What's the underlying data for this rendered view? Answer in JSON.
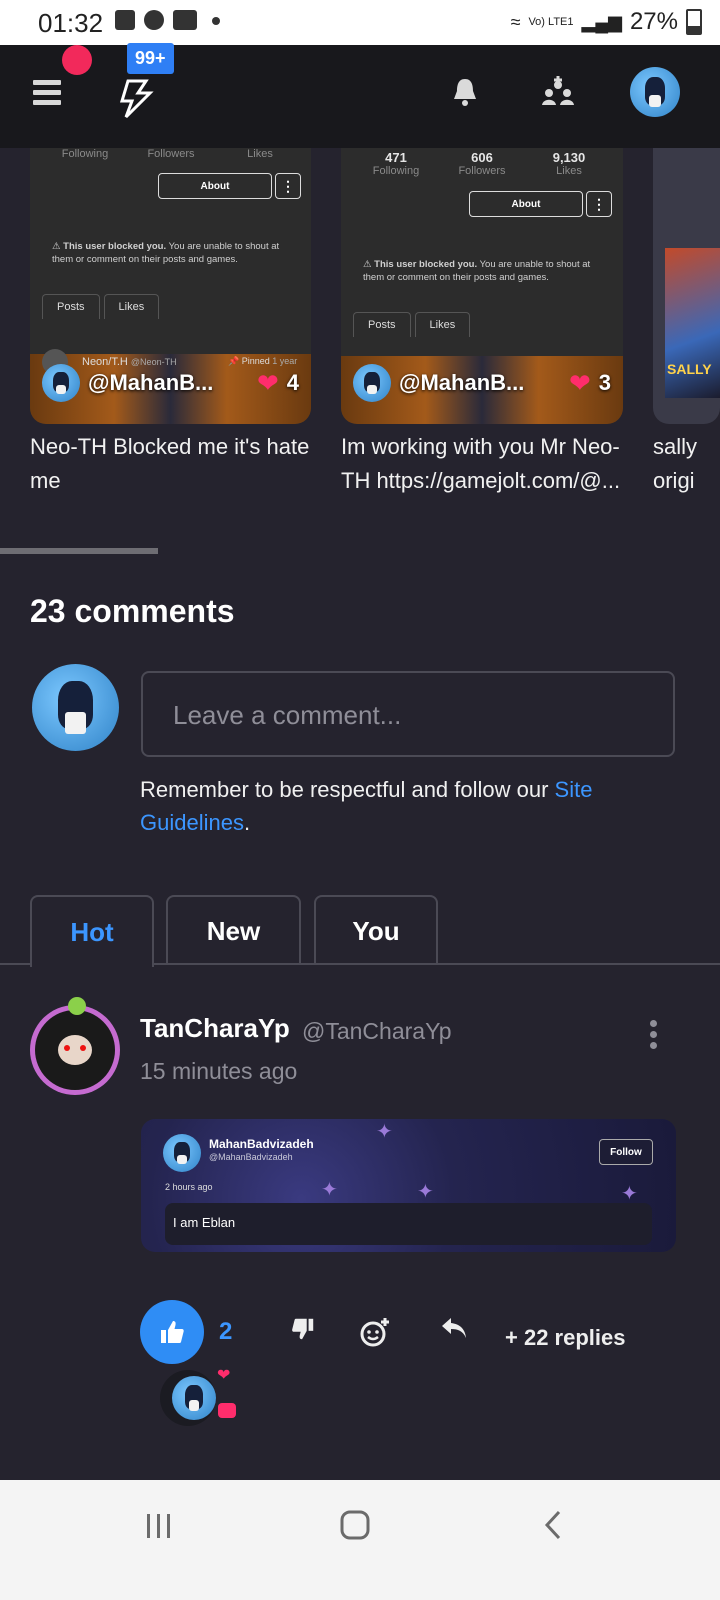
{
  "status_bar": {
    "time": "01:32",
    "battery": "27%",
    "network": "Vo) LTE1"
  },
  "header": {
    "notification_badge": "99+"
  },
  "cards": [
    {
      "stats": [
        {
          "value": "",
          "label": "Following"
        },
        {
          "value": "",
          "label": "Followers"
        },
        {
          "value": "",
          "label": "Likes"
        }
      ],
      "about": "About",
      "blocked_bold": "This user blocked you.",
      "blocked_text": "You are unable to shout at them or comment on their posts and games.",
      "tabs": [
        "Posts",
        "Likes"
      ],
      "post_user": "Neon/T.H",
      "post_handle": "@Neon-TH",
      "post_pinned": "Pinned",
      "post_time": "1 year",
      "handle": "@MahanB...",
      "likes": "4",
      "caption": "Neo-TH Blocked me it's hate me"
    },
    {
      "stats": [
        {
          "value": "471",
          "label": "Following"
        },
        {
          "value": "606",
          "label": "Followers"
        },
        {
          "value": "9,130",
          "label": "Likes"
        }
      ],
      "about": "About",
      "blocked_bold": "This user blocked you.",
      "blocked_text": "You are unable to shout at them or comment on their posts and games.",
      "tabs": [
        "Posts",
        "Likes"
      ],
      "handle": "@MahanB...",
      "likes": "3",
      "caption": "Im working with you Mr Neo-TH https://gamejolt.com/@..."
    },
    {
      "caption": "sally origi",
      "image_text": "SALLY"
    }
  ],
  "comments": {
    "title": "23 comments",
    "input_placeholder": "Leave a comment...",
    "guideline_text": "Remember to be respectful and follow our ",
    "guideline_link": "Site Guidelines",
    "guideline_end": ".",
    "tabs": [
      "Hot",
      "New",
      "You"
    ],
    "active_tab": "Hot"
  },
  "comment": {
    "author": "TanCharaYp",
    "handle": "@TanCharaYp",
    "time": "15 minutes ago",
    "embed": {
      "name": "MahanBadvizadeh",
      "handle": "@MahanBadvizadeh",
      "follow": "Follow",
      "time": "2 hours ago",
      "message": "I am Eblan"
    },
    "like_count": "2",
    "replies": "+ 22 replies"
  },
  "colors": {
    "accent": "#2f8df5",
    "link": "#3c96ff",
    "heart": "#ff2d6c",
    "background": "#25232e",
    "header": "#18181c"
  }
}
